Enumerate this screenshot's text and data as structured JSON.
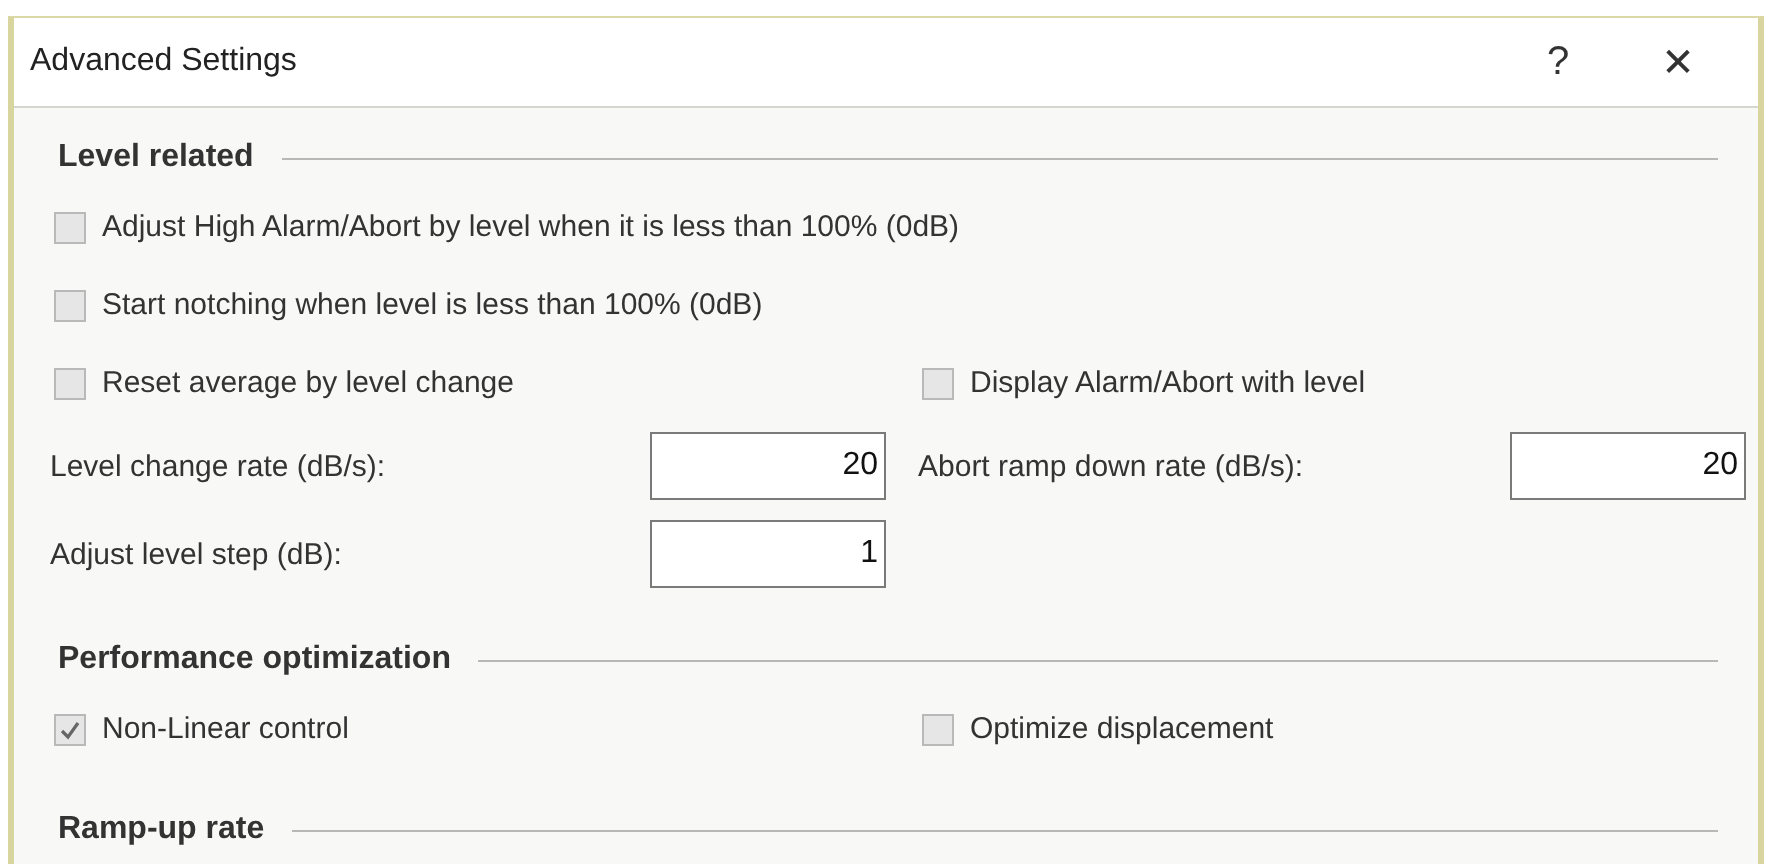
{
  "window": {
    "title": "Advanced Settings",
    "help": "?",
    "close": "✕"
  },
  "sections": [
    {
      "title": "Level related",
      "rows": [
        [
          {
            "kind": "checkbox",
            "label": "Adjust High Alarm/Abort by level when it is less than 100% (0dB)",
            "checked": false
          }
        ],
        [
          {
            "kind": "checkbox",
            "label": "Start notching when level is less than 100% (0dB)",
            "checked": false
          }
        ],
        [
          {
            "kind": "checkbox",
            "label": "Reset average by level change",
            "checked": false
          },
          {
            "kind": "checkbox",
            "label": "Display Alarm/Abort with level",
            "checked": false
          }
        ],
        [
          {
            "kind": "field",
            "label": "Level change rate (dB/s):",
            "value": "20"
          },
          {
            "kind": "field",
            "label": "Abort ramp down rate (dB/s):",
            "value": "20"
          }
        ],
        [
          {
            "kind": "field",
            "label": "Adjust level step (dB):",
            "value": "1"
          }
        ]
      ]
    },
    {
      "title": "Performance optimization",
      "rows": [
        [
          {
            "kind": "checkbox",
            "label": "Non-Linear control",
            "checked": true
          },
          {
            "kind": "checkbox",
            "label": "Optimize displacement",
            "checked": false
          }
        ]
      ]
    },
    {
      "title": "Ramp-up rate"
    }
  ]
}
